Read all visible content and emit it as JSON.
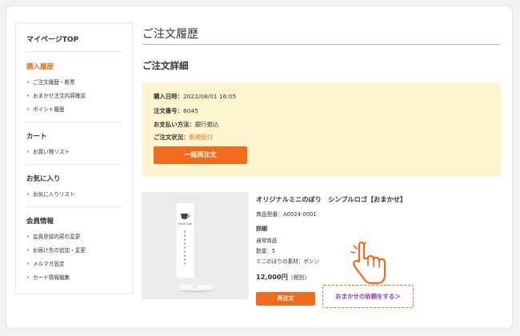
{
  "sidebar": {
    "top_label": "マイページTOP",
    "sections": [
      {
        "title": "購入履歴",
        "items": [
          "ご注文履歴・帳票",
          "おまかせ注文内容確認",
          "ポイント履歴"
        ]
      },
      {
        "title": "カート",
        "items": [
          "お買い物リスト"
        ]
      },
      {
        "title": "お気に入り",
        "items": [
          "お気に入りリスト"
        ]
      },
      {
        "title": "会員情報",
        "items": [
          "会員登録内容の変更",
          "お届け先の追加・変更",
          "メルマガ設定",
          "カード情報編集"
        ]
      }
    ]
  },
  "page": {
    "title": "ご注文履歴",
    "detail_title": "ご注文詳細"
  },
  "order": {
    "date_label": "購入日時：",
    "date_value": "2022/08/01 16:05",
    "number_label": "注文番号：",
    "number_value": "6045",
    "payment_label": "お支払い方法：",
    "payment_value": "銀行振込",
    "status_label": "ご注文状況：",
    "status_value": "新規受付",
    "reorder_all_label": "一括再注文"
  },
  "product": {
    "name": "オリジナルミニのぼり　シンプルロゴ【おまかせ】",
    "code": "商品型番：A0024-0001",
    "details_heading": "詳細",
    "details": [
      "通常商品",
      "数量：5",
      "ミニのぼりの素材：ポンジ"
    ],
    "price": "12,000円",
    "price_tax": "（税別）",
    "flag_logo_text": "Smile Cafe",
    "reorder_label": "再注文",
    "omakase_link": "おまかせの依頼をする＞"
  },
  "colors": {
    "accent": "#f26b1d",
    "link": "#8a3fa8",
    "infobox_bg": "#fdf5d0"
  },
  "icons": {
    "pointer": "hand-pointer-icon"
  }
}
